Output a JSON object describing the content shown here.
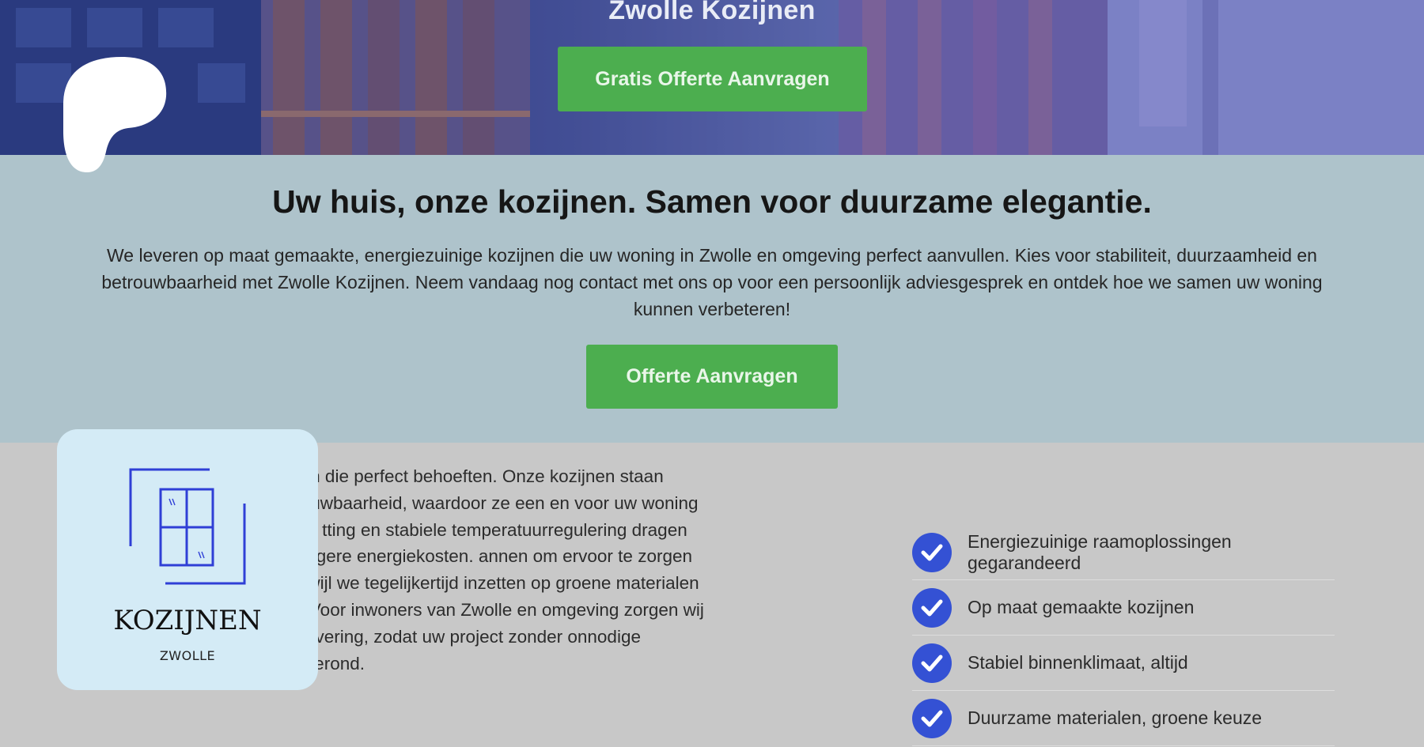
{
  "hero": {
    "title": "Zwolle Kozijnen",
    "button_label": "Gratis Offerte Aanvragen"
  },
  "cta": {
    "heading": "Uw huis, onze kozijnen. Samen voor duurzame elegantie.",
    "text": "We leveren op maat gemaakte, energiezuinige kozijnen die uw woning in Zwolle en omgeving perfect aanvullen. Kies voor stabiliteit, duurzaamheid en betrouwbaarheid met Zwolle Kozijnen. Neem vandaag nog contact met ons op voor een persoonlijk adviesgesprek en ontdek hoe we samen uw woning kunnen verbeteren!",
    "button_label": "Offerte Aanvragen"
  },
  "about": {
    "text": "j hoogwaardige raamkozijnen die perfect behoeften. Onze kozijnen staan bekend om hun eid en betrouwbaarheid, waardoor ze een en voor uw woning of bedrijfspand. Dankzij onze tting en stabiele temperatuurregulering dragen nfortabel binnenklimaat en lagere energiekosten. annen om ervoor te zorgen dat elke klant een op jgt, terwijl we tegelijkertijd inzetten op groene materialen en verantwoorde productie. Voor inwoners van Zwolle en omgeving zorgen wij bovendien voor een tijdige levering, zodat uw project zonder onnodige vertragingen kan worden afgerond."
  },
  "features": [
    {
      "label": "Energiezuinige raamoplossingen gegarandeerd",
      "icon": "check-circle-icon"
    },
    {
      "label": "Op maat gemaakte kozijnen",
      "icon": "check-circle-icon"
    },
    {
      "label": "Stabiel binnenklimaat, altijd",
      "icon": "check-circle-icon"
    },
    {
      "label": "Duurzame materialen, groene keuze",
      "icon": "check-circle-icon"
    }
  ],
  "logo": {
    "word": "KOZIJNEN",
    "sub": "ZWOLLE"
  },
  "colors": {
    "accent_green": "#4cae4f",
    "check_blue": "#3451d4",
    "cta_band": "#aec3cb",
    "logo_card": "#d4ebf6"
  }
}
